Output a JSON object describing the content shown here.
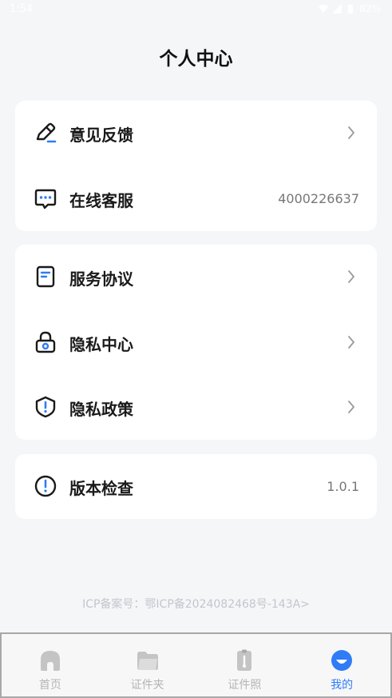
{
  "status_bar": {
    "time": "1:54",
    "battery": "82%"
  },
  "page_title": "个人中心",
  "group1": [
    {
      "label": "意见反馈",
      "icon": "edit-pen-icon",
      "trailing": "chevron"
    },
    {
      "label": "在线客服",
      "icon": "chat-bubble-icon",
      "value": "4000226637"
    }
  ],
  "group2": [
    {
      "label": "服务协议",
      "icon": "document-icon",
      "trailing": "chevron"
    },
    {
      "label": "隐私中心",
      "icon": "lock-icon",
      "trailing": "chevron"
    },
    {
      "label": "隐私政策",
      "icon": "shield-alert-icon",
      "trailing": "chevron"
    }
  ],
  "group3": [
    {
      "label": "版本检查",
      "icon": "info-alert-icon",
      "value": "1.0.1"
    }
  ],
  "icp": "ICP备案号：鄂ICP备2024082468号-143A>",
  "tabs": [
    {
      "label": "首页",
      "icon": "home-icon",
      "active": false
    },
    {
      "label": "证件夹",
      "icon": "folder-icon",
      "active": false
    },
    {
      "label": "证件照",
      "icon": "id-photo-icon",
      "active": false
    },
    {
      "label": "我的",
      "icon": "profile-smile-icon",
      "active": true
    }
  ],
  "colors": {
    "accent": "#2f7cf6",
    "icon_stroke": "#1a1a1a",
    "inactive_tab": "#b5b5b5",
    "background": "#f5f6f8"
  }
}
